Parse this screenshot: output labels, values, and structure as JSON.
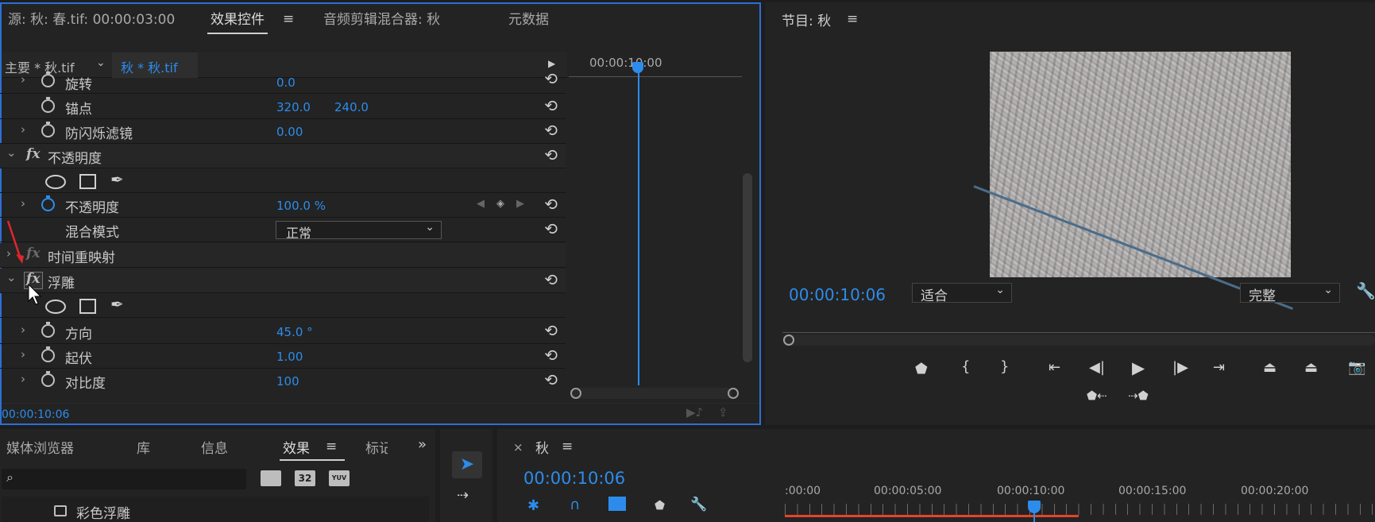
{
  "source_panel": {
    "tab_source": "源: 秋: 春.tif: 00:00:03:00",
    "tab_effect_controls": "效果控件",
    "tab_audio_mixer": "音频剪辑混合器: 秋",
    "tab_metadata": "元数据",
    "master_clip": "主要 * 秋.tif",
    "sequence_clip": "秋 * 秋.tif",
    "ruler_time": "00:00:10:00",
    "footer_time": "00:00:10:06"
  },
  "effect_rows": [
    {
      "label": "旋转",
      "value": "0.0"
    },
    {
      "label": "锚点",
      "value": "320.0",
      "value2": "240.0"
    },
    {
      "label": "防闪烁滤镜",
      "value": "0.00"
    },
    {
      "label": "不透明度"
    },
    {
      "label": "不透明度",
      "value": "100.0 %"
    },
    {
      "label": "混合模式",
      "value": "正常"
    },
    {
      "label": "时间重映射"
    },
    {
      "label": "浮雕"
    },
    {
      "label": "方向",
      "value": "45.0 °"
    },
    {
      "label": "起伏",
      "value": "1.00"
    },
    {
      "label": "对比度",
      "value": "100"
    }
  ],
  "program_panel": {
    "title": "节目: 秋",
    "timecode": "00:00:10:06",
    "fit_select": "适合",
    "quality_select": "完整"
  },
  "bottom_left": {
    "tabs": [
      "媒体浏览器",
      "库",
      "信息",
      "效果",
      "标记"
    ],
    "active_tab": "效果",
    "search_placeholder": "",
    "badge_32": "32",
    "badge_yuv": "YUV",
    "list_item": "彩色浮雕"
  },
  "timeline": {
    "title": "秋",
    "timecode": "00:00:10:06",
    "ruler": [
      ":00:00",
      "00:00:05:00",
      "00:00:10:00",
      "00:00:15:00",
      "00:00:20:00"
    ]
  },
  "icons": {
    "menu": "hamburger-icon",
    "reset": "reset-icon",
    "stopwatch": "stopwatch-icon"
  },
  "colors": {
    "accent": "#2d8ceb",
    "panel_border": "#2d6fd6",
    "work_area": "#e5442b",
    "arrow": "#e0262b"
  }
}
